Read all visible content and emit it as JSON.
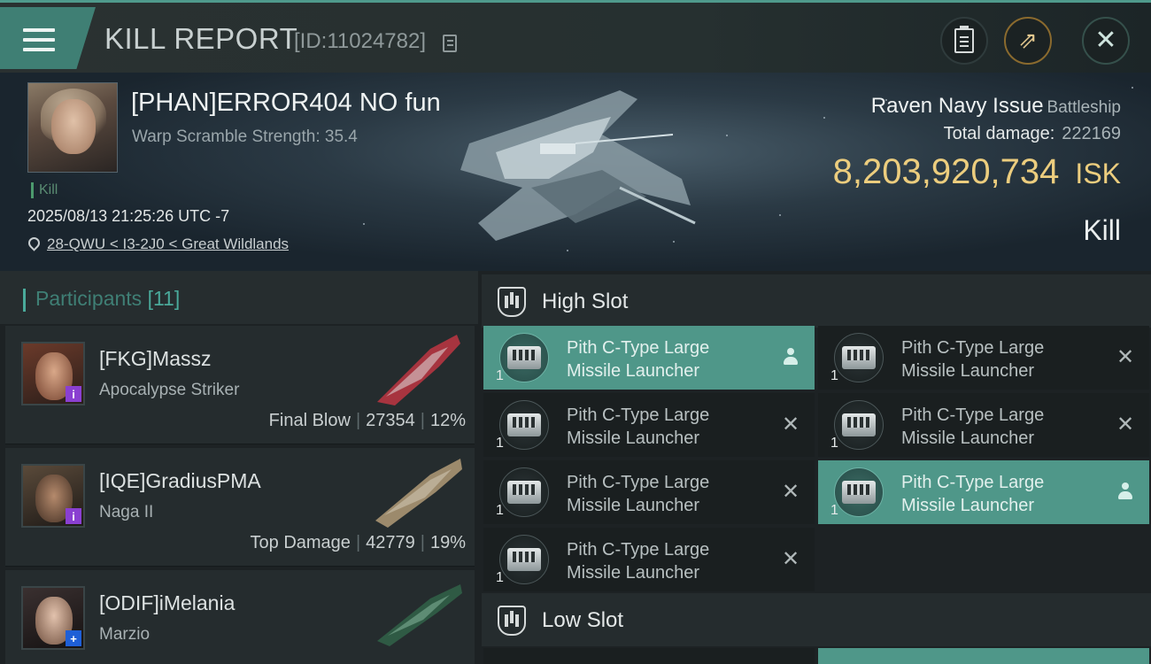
{
  "header": {
    "title": "KILL REPORT",
    "report_id": "[ID:11024782]",
    "icons": [
      "menu-icon",
      "copy-icon",
      "clipboard-icon",
      "share-icon",
      "close-icon"
    ]
  },
  "victim": {
    "name": "[PHAN]ERROR404 NO fun",
    "warp_scramble": "Warp Scramble Strength: 35.4",
    "tag": "Kill",
    "timestamp": "2025/08/13 21:25:26 UTC -7",
    "location": "28-QWU < I3-2J0 < Great Wildlands",
    "ship_name": "Raven Navy Issue",
    "ship_class": "Battleship",
    "total_damage_label": "Total damage:",
    "total_damage": "222169",
    "isk_value": "8,203,920,734",
    "isk_unit": "ISK",
    "result": "Kill"
  },
  "participants": {
    "title": "Participants",
    "count": "[11]",
    "rows": [
      {
        "name": "[FKG]Massz",
        "ship": "Apocalypse Striker",
        "role": "Final Blow",
        "damage": "27354",
        "percent": "12%",
        "badge": "i",
        "badge_color": "#8a3fd1"
      },
      {
        "name": "[IQE]GradiusPMA",
        "ship": "Naga II",
        "role": "Top Damage",
        "damage": "42779",
        "percent": "19%",
        "badge": "i",
        "badge_color": "#8a3fd1"
      },
      {
        "name": "[ODIF]iMelania",
        "ship": "Marzio",
        "role": "",
        "damage": "",
        "percent": "",
        "badge": "+",
        "badge_color": "#1e5fd6"
      }
    ]
  },
  "slots": {
    "high_slot_label": "High Slot",
    "low_slot_label": "Low Slot",
    "high_modules": [
      {
        "name_line1": "Pith C-Type Large",
        "name_line2": "Missile Launcher",
        "qty": "1",
        "status": "dropped"
      },
      {
        "name_line1": "Pith C-Type Large",
        "name_line2": "Missile Launcher",
        "qty": "1",
        "status": "destroyed"
      },
      {
        "name_line1": "Pith C-Type Large",
        "name_line2": "Missile Launcher",
        "qty": "1",
        "status": "destroyed"
      },
      {
        "name_line1": "Pith C-Type Large",
        "name_line2": "Missile Launcher",
        "qty": "1",
        "status": "destroyed"
      },
      {
        "name_line1": "Pith C-Type Large",
        "name_line2": "Missile Launcher",
        "qty": "1",
        "status": "destroyed"
      },
      {
        "name_line1": "Pith C-Type Large",
        "name_line2": "Missile Launcher",
        "qty": "1",
        "status": "dropped"
      },
      {
        "name_line1": "Pith C-Type Large",
        "name_line2": "Missile Launcher",
        "qty": "1",
        "status": "destroyed"
      }
    ]
  },
  "colors": {
    "accent": "#4f9789",
    "isk": "#eccd7e"
  }
}
